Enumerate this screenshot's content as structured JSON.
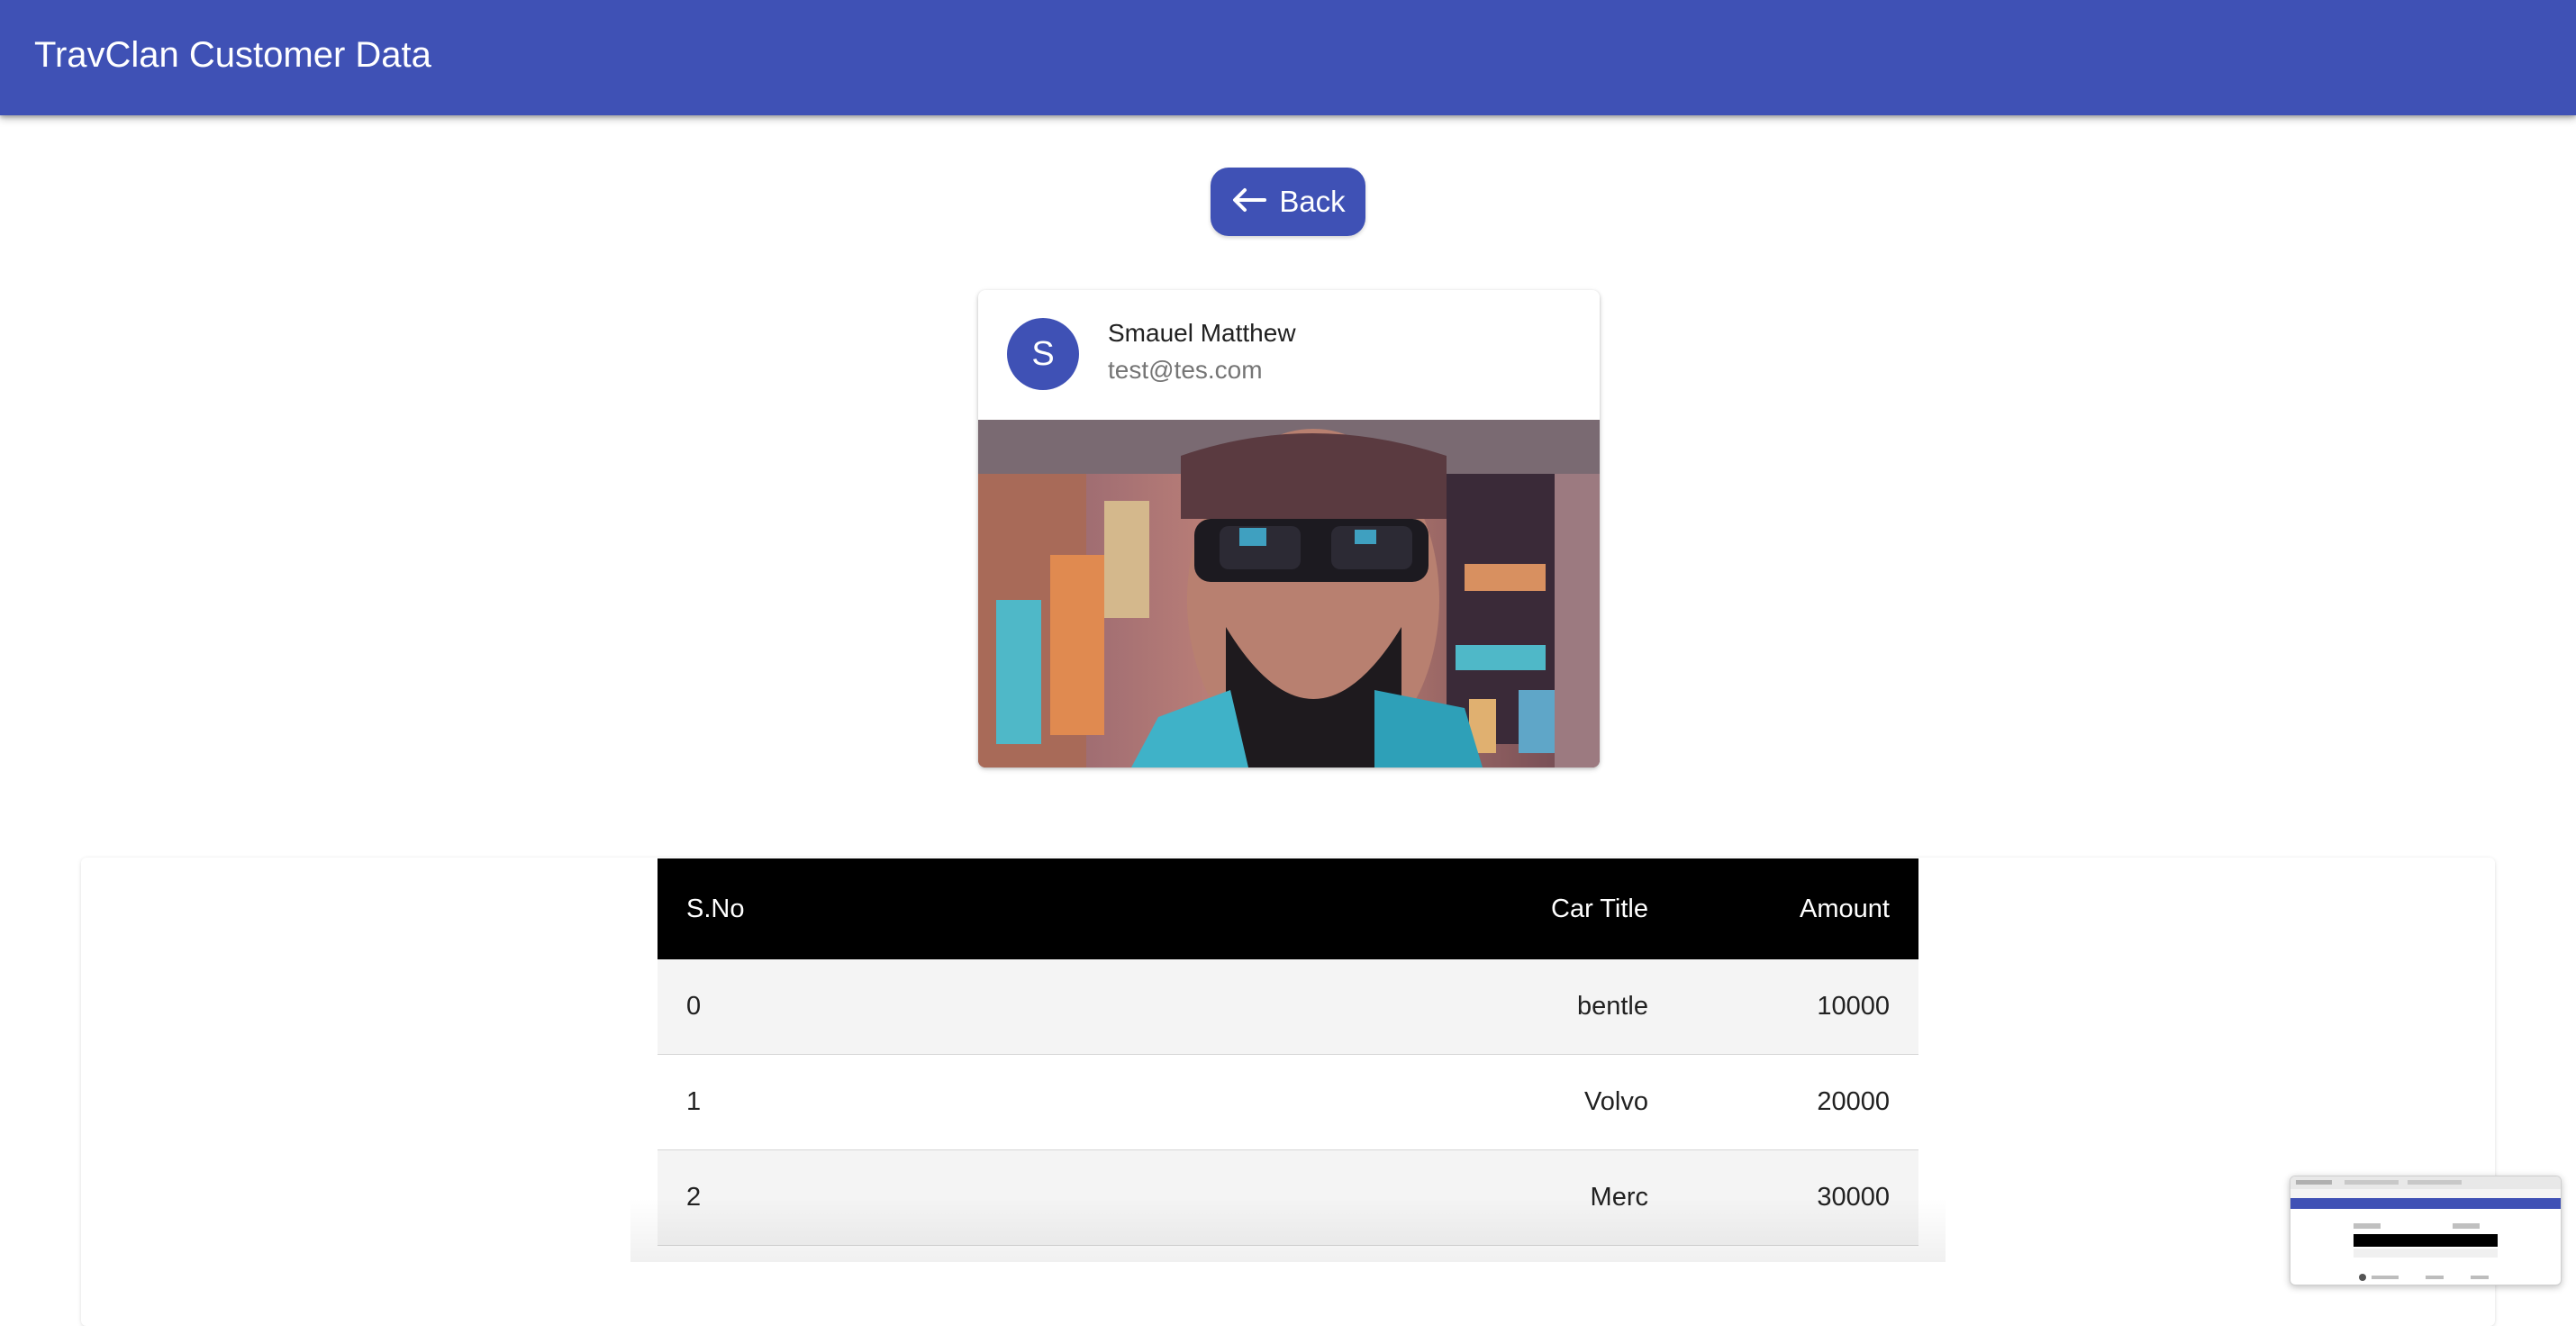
{
  "appbar": {
    "title": "TravClan Customer Data"
  },
  "back_button": {
    "label": "Back",
    "icon": "arrow-left-icon"
  },
  "customer_card": {
    "avatar_letter": "S",
    "name": "Smauel Matthew",
    "email": "test@tes.com",
    "image_icon": "customer-photo"
  },
  "bids_table": {
    "headers": [
      "S.No",
      "Car Title",
      "Amount"
    ],
    "rows": [
      {
        "sno": "0",
        "car_title": "bentle",
        "amount": "10000"
      },
      {
        "sno": "1",
        "car_title": "Volvo",
        "amount": "20000"
      },
      {
        "sno": "2",
        "car_title": "Merc",
        "amount": "30000"
      }
    ]
  },
  "colors": {
    "primary": "#3f51b5",
    "table_header_bg": "#000000",
    "row_alt_bg": "#f4f4f4"
  }
}
